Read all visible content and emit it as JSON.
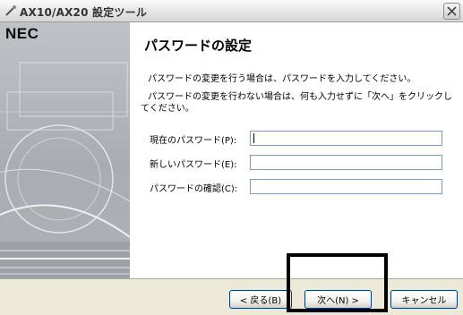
{
  "window": {
    "title": "AX10/AX20 設定ツール",
    "title_icon": "app-wand-icon",
    "close_icon": "close-icon"
  },
  "sidebar": {
    "brand": "NEC"
  },
  "main": {
    "heading": "パスワードの設定",
    "description_1": "パスワードの変更を行う場合は、パスワードを入力してください。",
    "description_2": "パスワードの変更を行わない場合は、何も入力せずに「次へ」をクリックしてください。",
    "fields": [
      {
        "label": "現在のパスワード(P):",
        "value": ""
      },
      {
        "label": "新しいパスワード(E):",
        "value": ""
      },
      {
        "label": "パスワードの確認(C):",
        "value": ""
      }
    ]
  },
  "footer": {
    "back_label": "< 戻る(B)",
    "next_label": "次へ(N) >",
    "cancel_label": "キャンセル"
  },
  "colors": {
    "highlight_border": "#000000",
    "input_border": "#7f9db9",
    "footer_bg": "#ece9d8"
  }
}
